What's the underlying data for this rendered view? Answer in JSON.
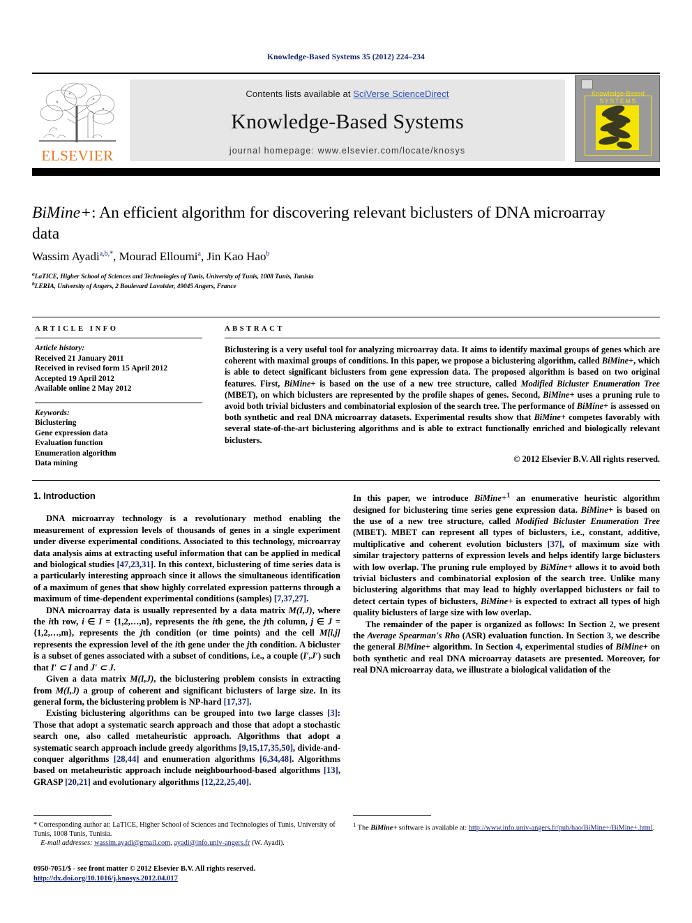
{
  "running_head": "Knowledge-Based Systems 35 (2012) 224–234",
  "masthead": {
    "elsevier_wordmark": "ELSEVIER",
    "contents_prefix": "Contents lists available at ",
    "contents_link": "SciVerse ScienceDirect",
    "journal_name": "Knowledge-Based Systems",
    "homepage": "journal homepage: www.elsevier.com/locate/knosys",
    "cover_title_line1": "Knowledge-Based",
    "cover_title_line2": "SYSTEMS"
  },
  "article": {
    "title_italic": "BiMine+",
    "title_rest": ": An efficient algorithm for discovering relevant biclusters of DNA microarray data",
    "authors_html": "Wassim Ayadi, Mourad Elloumi, Jin Kao Hao",
    "author1": "Wassim Ayadi",
    "author1_sup": "a,b,*",
    "author2": "Mourad Elloumi",
    "author2_sup": "a",
    "author3": "Jin Kao Hao",
    "author3_sup": "b",
    "affiliation_a_sup": "a",
    "affiliation_a": "LaTICE, Higher School of Sciences and Technologies of Tunis, University of Tunis, 1008 Tunis, Tunisia",
    "affiliation_b_sup": "b",
    "affiliation_b": "LERIA, University of Angers, 2 Boulevard Lavoisier, 49045 Angers, France"
  },
  "info": {
    "heading": "ARTICLE INFO",
    "history_label": "Article history:",
    "history": [
      "Received 21 January 2011",
      "Received in revised form 15 April 2012",
      "Accepted 19 April 2012",
      "Available online 2 May 2012"
    ],
    "keywords_label": "Keywords:",
    "keywords": [
      "Biclustering",
      "Gene expression data",
      "Evaluation function",
      "Enumeration algorithm",
      "Data mining"
    ]
  },
  "abstract": {
    "heading": "ABSTRACT",
    "p1_a": "Biclustering is a very useful tool for analyzing microarray data. It aims to identify maximal groups of genes which are coherent with maximal groups of conditions. In this paper, we propose a biclustering algorithm, called ",
    "p1_i1": "BiMine+",
    "p1_b": ", which is able to detect significant biclusters from gene expression data. The proposed algorithm is based on two original features. First, ",
    "p1_i2": "BiMine+",
    "p1_c": " is based on the use of a new tree structure, called ",
    "p1_i3": "Modified Bicluster Enumeration Tree",
    "p1_d": " (MBET), on which biclusters are represented by the profile shapes of genes. Second, ",
    "p1_i4": "BiMine+",
    "p1_e": " uses a pruning rule to avoid both trivial biclusters and combinatorial explosion of the search tree. The performance of ",
    "p1_i5": "BiMine+",
    "p1_f": " is assessed on both synthetic and real DNA microarray datasets. Experimental results show that ",
    "p1_i6": "BiMine+",
    "p1_g": " competes favorably with several state-of-the-art biclustering algorithms and is able to extract functionally enriched and biologically relevant biclusters.",
    "copyright": "© 2012 Elsevier B.V. All rights reserved."
  },
  "section1": {
    "heading": "1. Introduction",
    "p1_a": "DNA microarray technology is a revolutionary method enabling the measurement of expression levels of thousands of genes in a single experiment under diverse experimental conditions. Associated to this technology, microarray data analysis aims at extracting useful information that can be applied in medical and biological studies ",
    "p1_r1": "[47,23,31]",
    "p1_b": ". In this context, biclustering of time series data is a particularly interesting approach since it allows the simultaneous identification of a maximum of genes that show highly correlated expression patterns through a maximum of time-dependent experimental conditions (samples) ",
    "p1_r2": "[7,37,27]",
    "p1_c": ".",
    "p2_a": "DNA microarray data is usually represented by a data matrix ",
    "p2_i1": "M(I,J)",
    "p2_b": ", where the ",
    "p2_i2": "i",
    "p2_c": "th row, ",
    "p2_i3": "i",
    "p2_d": " ∈ ",
    "p2_i4": "I",
    "p2_e": " = {1,2,…,n}, represents the ",
    "p2_i5": "i",
    "p2_f": "th gene, the ",
    "p2_i6": "j",
    "p2_g": "th column, ",
    "p2_i7": "j",
    "p2_h": " ∈ ",
    "p2_i8": "J",
    "p2_j": " = {1,2,…,m}, represents the ",
    "p2_i9": "j",
    "p2_k": "th condition (or time points) and the cell ",
    "p2_i10": "M[i,j]",
    "p2_l": " represents the expression level of the ",
    "p2_i11": "i",
    "p2_m": "th gene under the ",
    "p2_i12": "j",
    "p2_n": "th condition. A bicluster is a subset of genes associated with a subset of conditions, i.e., a couple (",
    "p2_i13": "I′,J′",
    "p2_o": ") such that ",
    "p2_i14": "I′ ⊂ I",
    "p2_p": " and ",
    "p2_i15": "J′ ⊂ J",
    "p2_q": ".",
    "p3_a": "Given a data matrix ",
    "p3_i1": "M(I,J)",
    "p3_b": ", the biclustering problem consists in extracting from ",
    "p3_i2": "M(I,J)",
    "p3_c": " a group of coherent and significant biclusters of large size. In its general form, the biclustering problem is NP-hard ",
    "p3_r1": "[17,37]",
    "p3_d": ".",
    "p4_a": "Existing biclustering algorithms can be grouped into two large classes ",
    "p4_r1": "[3]",
    "p4_b": ": Those that adopt a systematic search approach and those that adopt a stochastic search one, also called metaheuristic approach. Algorithms that adopt a systematic search approach include greedy algorithms ",
    "p4_r2": "[9,15,17,35,50]",
    "p4_c": ", divide-and-conquer algorithms ",
    "p4_r3": "[28,44]",
    "p4_d": " and enumeration algorithms ",
    "p4_r4": "[6,34,48]",
    "p4_e": ". Algorithms based on metaheuristic approach include neighbourhood-based algorithms ",
    "p4_r5": "[13]",
    "p4_f": ", GRASP ",
    "p4_r6": "[20,21]",
    "p4_g": " and evolutionary algorithms ",
    "p4_r7": "[12,22,25,40]",
    "p4_h": ".",
    "p5_a": "In this paper, we introduce ",
    "p5_i1": "BiMine+",
    "p5_sup": "1",
    "p5_b": " an enumerative heuristic algorithm designed for biclustering time series gene expression data. ",
    "p5_i2": "BiMine+",
    "p5_c": " is based on the use of a new tree structure, called ",
    "p5_i3": "Modified Bicluster Enumeration Tree",
    "p5_d": " (MBET). MBET can represent all types of biclusters, i.e., constant, additive, multiplicative and coherent evolution biclusters ",
    "p5_r1": "[37]",
    "p5_e": ", of maximum size with similar trajectory patterns of expression levels and helps identify large biclusters with low overlap. The pruning rule employed by ",
    "p5_i4": "BiMine+",
    "p5_f": " allows it to avoid both trivial biclusters and combinatorial explosion of the search tree. Unlike many biclustering algorithms that may lead to highly overlapped biclusters or fail to detect certain types of biclusters, ",
    "p5_i5": "BiMine+",
    "p5_g": " is expected to extract all types of high quality biclusters of large size with low overlap.",
    "p6_a": "The remainder of the paper is organized as follows: In Section ",
    "p6_r1": "2",
    "p6_b": ", we present the ",
    "p6_i1": "Average Spearman's Rho",
    "p6_c": " (ASR) evaluation function. In Section ",
    "p6_r2": "3",
    "p6_d": ", we describe the general ",
    "p6_i2": "BiMine+",
    "p6_e": " algorithm. In Section ",
    "p6_r3": "4",
    "p6_f": ", experimental studies of ",
    "p6_i3": "BiMine+",
    "p6_g": " on both synthetic and real DNA microarray datasets are presented. Moreover, for real DNA microarray data, we illustrate a biological validation of the"
  },
  "footnotes": {
    "left_marker": "*",
    "left_text": " Corresponding author at: LaTICE, Higher School of Sciences and Technologies of Tunis, University of Tunis, 1008 Tunis, Tunisia.",
    "email_label": "E-mail addresses:",
    "email1": "wassim.ayadi@gmail.com",
    "email_sep": ", ",
    "email2": "ayadi@info.univ-angers.fr",
    "email_suffix": " (W. Ayadi).",
    "right_marker": "1",
    "right_a": " The ",
    "right_i": "BiMine+",
    "right_b": " software is available at: ",
    "right_link": "http://www.info.univ-angers.fr/pub/hao/BiMine+/BiMine+.html",
    "right_c": "."
  },
  "imprint": {
    "line1": "0950-7051/$ - see front matter © 2012 Elsevier B.V. All rights reserved.",
    "doi": "http://dx.doi.org/10.1016/j.knosys.2012.04.017"
  },
  "colors": {
    "link_blue": "#14216b",
    "sciencedirect_blue": "#2a4fb7",
    "elsevier_orange": "#e87722",
    "cover_yellow": "#f2e21a",
    "band_black": "#000000",
    "contents_gray": "#e6e6e6"
  }
}
